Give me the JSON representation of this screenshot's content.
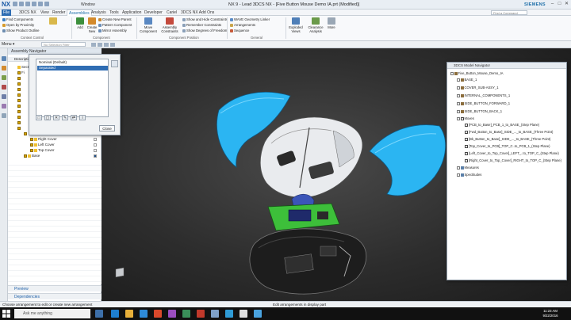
{
  "titlebar": {
    "app_logo": "NX",
    "window_menu": "Window",
    "title": "NX 9 - Lead 3DCS NX - [Five Button Mouse Demo IA.prt (Modified)]",
    "brand": "SIEMENS",
    "minimize": "–",
    "maximize": "□",
    "close": "✕"
  },
  "menutabs": {
    "tabs": [
      "File",
      "3DCS NX",
      "View",
      "Render",
      "Assemblies",
      "Analysis",
      "Tools",
      "Application",
      "Developer",
      "Cariel",
      "3DCS NX Add Ons"
    ],
    "active": "Assemblies",
    "search_placeholder": "Find a Command"
  },
  "ribbon": {
    "context_control": [
      "Find Components",
      "Open by Proximity",
      "Show Product Outline"
    ],
    "context_control_label": "Context Control",
    "component_big": [
      "Add",
      "Create New",
      "Mirror Assembly"
    ],
    "component_small": [
      "Create New Parent",
      "Pattern Component",
      "Mirror Assembly"
    ],
    "component_label": "Component",
    "position_big": [
      "Move Component",
      "Assembly Constraints"
    ],
    "position_small": [
      "Show and Hide Constraints",
      "Remember Constraints",
      "Show Degrees of Freedom"
    ],
    "position_label": "Component Position",
    "general_small": [
      "WAVE Geometry Linker",
      "Arrangements",
      "Sequence"
    ],
    "general_label": "General",
    "general_big": [
      "Exploded Views",
      "Clearance Analysis",
      "More"
    ]
  },
  "selbar": {
    "menu": "Menu ▾",
    "filter_placeholder": "No Selection Filter"
  },
  "navigator": {
    "header": "Assembly Navigator",
    "col_description": "Description",
    "rows": [
      {
        "label": "Sectio",
        "indent": 6
      },
      {
        "label": "Fi",
        "indent": 6
      },
      {
        "label": "Right Cover",
        "indent": 22
      },
      {
        "label": "Left Cover",
        "indent": 22
      },
      {
        "label": "Top Cover",
        "indent": 22
      },
      {
        "label": "Base",
        "indent": 14
      }
    ],
    "preview": "Preview",
    "dependencies": "Dependencies"
  },
  "dialog": {
    "items": [
      "Nominal (Default)",
      "Separated"
    ],
    "selected": "Separated",
    "close": "Close",
    "tools": [
      "□",
      "▢",
      "✕",
      "✎",
      "⇄",
      "i"
    ]
  },
  "model_navigator": {
    "title": "3DCS Model Navigator",
    "root": "Five_Button_Mouse_Demo_IA",
    "parts": [
      "BASE_1",
      "COVER_SUB-ASSY_1",
      "INTERNAL_COMPONENTS_1",
      "SIDE_BUTTON_FORWARD_1",
      "SIDE_BUTTON_BACK_1"
    ],
    "moves_label": "Moves",
    "moves": [
      "[PCB_to_Base]_PCB_1_to_BASE_(Step Plane)",
      "[Fwd_Button_to_Base]_SIDE_..._to_BASE_(Three Point)",
      "[Bk_Button_to_Base]_SIDE_..._to_BASE_(Three Point)",
      "[Top_Cover_to_PCB]_TOP_C..to_PCB_1_(Step Plane)",
      "[Left_Cover_to_Top_Cover]_LEFT_..to_TOP_C_(Step Plane)",
      "[Right_Cover_to_Top_Cover]_RIGHT_to_TOP_C_(Step Plane)"
    ],
    "measures": "Measures",
    "spectitudes": "Spectitudes"
  },
  "status": {
    "left": "Choose arrangement to edit or create new arrangement",
    "center": "Edit arrangements in display part"
  },
  "taskbar": {
    "search": "Ask me anything",
    "time": "11:23 AM",
    "date": "9/22/2016"
  },
  "colors": {
    "accent": "#2f6db3",
    "cover_blue": "#2bb5f2",
    "pcb_green": "#3dbf3a",
    "viewport_bg": "#2d2d2d"
  }
}
